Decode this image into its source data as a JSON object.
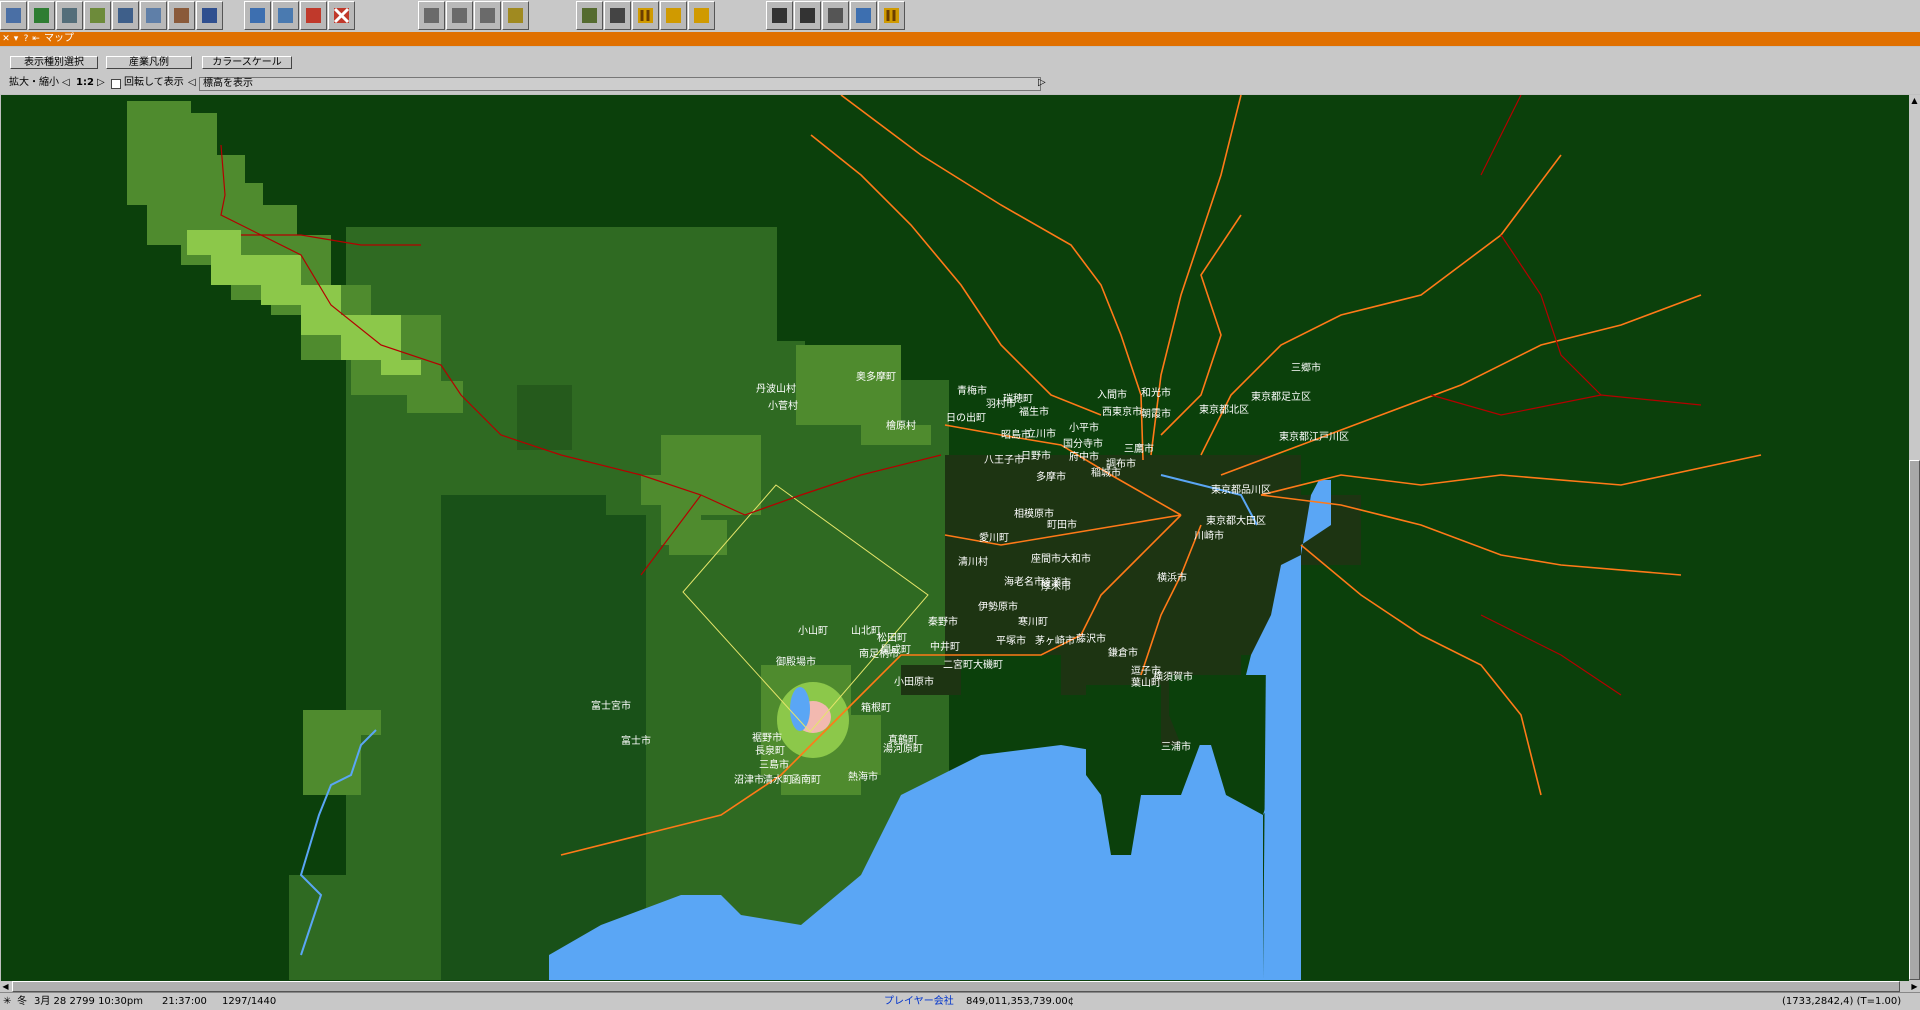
{
  "toolbar": {
    "tools": [
      "save-icon",
      "minimap-icon",
      "inspect-icon",
      "terrain-icon",
      "rail-icon",
      "road-icon",
      "station-icon",
      "depot-icon",
      "monorail-icon",
      "airport-icon",
      "target-icon",
      "remove-icon",
      "list-icon",
      "schedule-icon",
      "report-icon",
      "finance-icon",
      "map-icon",
      "screenshot-icon",
      "pause-icon",
      "fastforward-icon",
      "help-icon",
      "zoom-in-icon",
      "zoom-out-icon",
      "grid-icon",
      "waypoint-icon",
      "pause2-icon"
    ]
  },
  "window": {
    "title": "マップ"
  },
  "panel": {
    "filter_button": "表示種別選択",
    "industry_button": "産業凡例",
    "color_scale_button": "カラースケール",
    "zoom_label": "拡大・縮小",
    "zoom_value": "1:2",
    "rotate_label": "回転して表示",
    "height_label": "標高を表示"
  },
  "map": {
    "colors": {
      "background": "#0b400b",
      "sea": "#5aa6f5",
      "terrain_mid": "#2f6a22",
      "terrain_high": "#4f8b2e",
      "terrain_peak": "#8cc84a",
      "rail": "#ff7a18",
      "rail_dark": "#b40000"
    },
    "city_labels": [
      "丹波山村",
      "小菅村",
      "奥多摩町",
      "青梅市",
      "檜原村",
      "日の出町",
      "羽村市",
      "瑞穂町",
      "入間市",
      "福生市",
      "立川市",
      "小平市",
      "西東京市",
      "昭島市",
      "日野市",
      "国分寺市",
      "八王子市",
      "府中市",
      "三鷹市",
      "多摩市",
      "稲城市",
      "調布市",
      "相模原市",
      "町田市",
      "愛川町",
      "清川村",
      "座間市",
      "大和市",
      "海老名市",
      "綾瀬市",
      "伊勢原市",
      "厚木市",
      "秦野市",
      "寒川町",
      "平塚市",
      "茅ヶ崎市",
      "藤沢市",
      "鎌倉市",
      "逗子市",
      "葉山町",
      "横須賀市",
      "三浦市",
      "横浜市",
      "川崎市",
      "東京都大田区",
      "東京都品川区",
      "東京都江戸川区",
      "東京都足立区",
      "東京都北区",
      "三郷市",
      "和光市",
      "朝霞市",
      "小山町",
      "山北町",
      "松田町",
      "開成町",
      "南足柄市",
      "中井町",
      "二宮町",
      "大磯町",
      "小田原市",
      "御殿場市",
      "箱根町",
      "湯河原町",
      "真鶴町",
      "熱海市",
      "裾野市",
      "長泉町",
      "三島市",
      "沼津市",
      "清水町",
      "函南町",
      "富士宮市",
      "富士市"
    ]
  },
  "status": {
    "season": "冬",
    "date": "3月 28 2799 10:30pm",
    "clock": "21:37:00",
    "ratio": "1297/1440",
    "company": "プレイヤー会社",
    "money": "849,011,353,739.00¢",
    "coords": "(1733,2842,4) (T=1.00)"
  }
}
